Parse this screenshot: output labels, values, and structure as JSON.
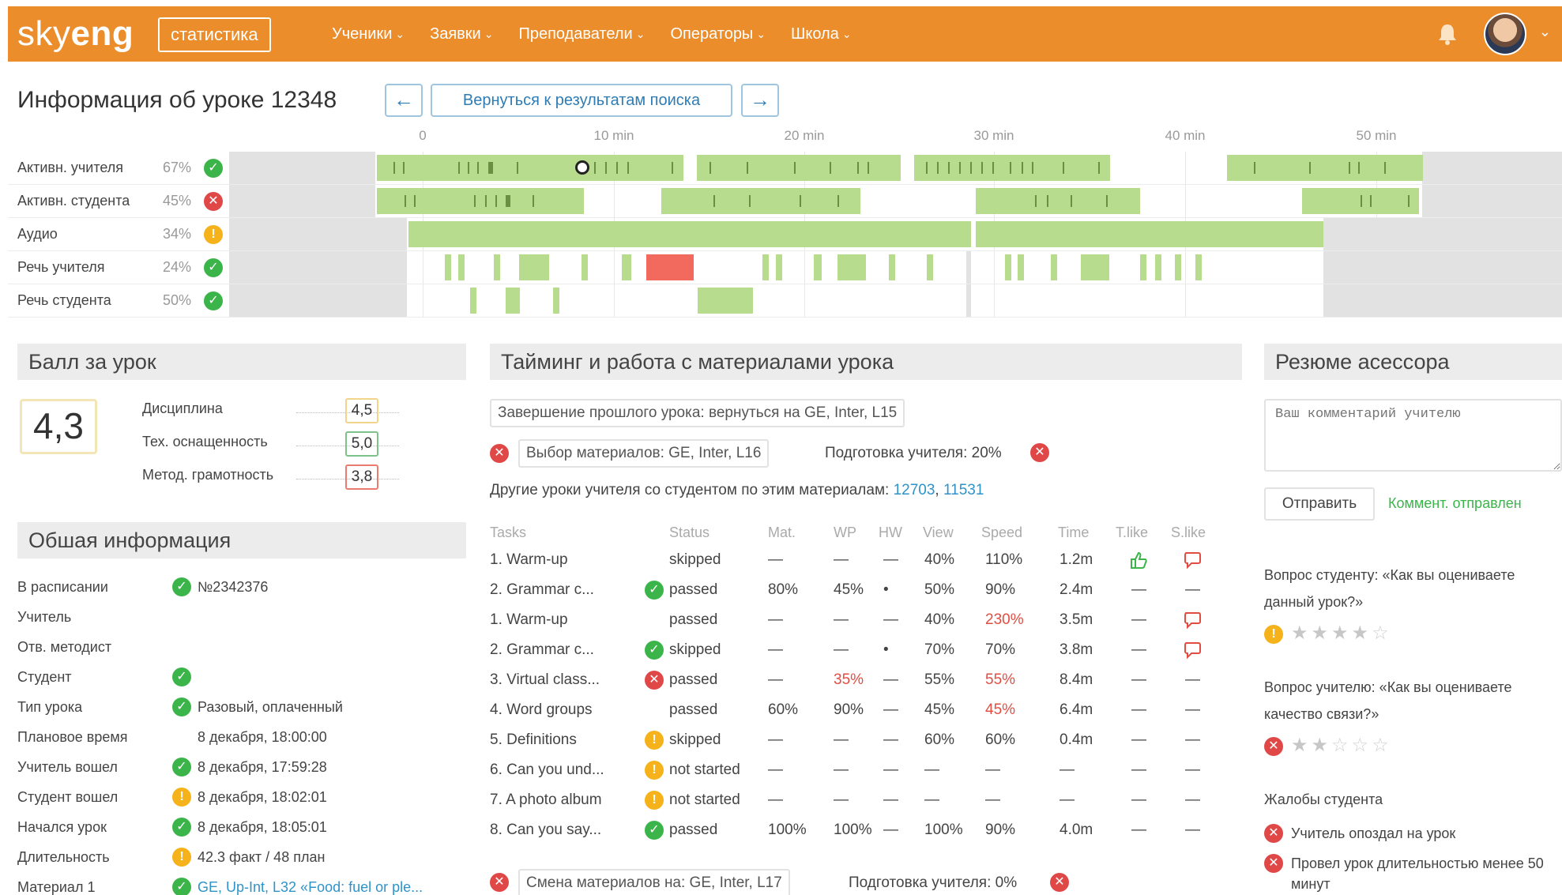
{
  "topbar": {
    "logo_light": "sky",
    "logo_bold": "eng",
    "stat_button": "статистика",
    "nav": [
      {
        "label": "Ученики"
      },
      {
        "label": "Заявки"
      },
      {
        "label": "Преподаватели"
      },
      {
        "label": "Операторы"
      },
      {
        "label": "Школа"
      }
    ],
    "accent_color": "#ec8d2c"
  },
  "lesson": {
    "title": "Информация об уроке 12348",
    "back_label": "Вернуться к результатам поиска",
    "prev_arrow": "←",
    "next_arrow": "→"
  },
  "timeline": {
    "ticks": [
      "0",
      "10 min",
      "20 min",
      "30 min",
      "40 min",
      "50 min"
    ],
    "rows": [
      {
        "label": "Активн. учителя",
        "pct": "67%",
        "status": "ok"
      },
      {
        "label": "Активн. студента",
        "pct": "45%",
        "status": "err"
      },
      {
        "label": "Аудио",
        "pct": "34%",
        "status": "warn"
      },
      {
        "label": "Речь учителя",
        "pct": "24%",
        "status": "ok"
      },
      {
        "label": "Речь студента",
        "pct": "50%",
        "status": "ok"
      }
    ]
  },
  "score": {
    "heading": "Балл за урок",
    "total": "4,3",
    "items": [
      {
        "label": "Дисциплина",
        "value": "4,5",
        "color": "#f2d48a"
      },
      {
        "label": "Тех. оснащенность",
        "value": "5,0",
        "color": "#7cc28a"
      },
      {
        "label": "Метод. грамотность",
        "value": "3,8",
        "color": "#ea7b6e"
      }
    ]
  },
  "info": {
    "heading": "Обшая информация",
    "rows": [
      {
        "label": "В расписании",
        "status": "ok",
        "value": "№2342376"
      },
      {
        "label": "Учитель",
        "status": "",
        "value": ""
      },
      {
        "label": "Отв. методист",
        "status": "",
        "value": ""
      },
      {
        "label": "Студент",
        "status": "ok",
        "value": ""
      },
      {
        "label": "Тип урока",
        "status": "ok",
        "value": "Разовый, оплаченный"
      },
      {
        "label": "Плановое время",
        "status": "",
        "value": "8 декабря, 18:00:00"
      },
      {
        "label": "Учитель вошел",
        "status": "ok",
        "value": "8 декабря, 17:59:28"
      },
      {
        "label": "Студент вошел",
        "status": "warn",
        "value": "8 декабря, 18:02:01"
      },
      {
        "label": "Начался урок",
        "status": "ok",
        "value": "8 декабря, 18:05:01"
      },
      {
        "label": "Длительность",
        "status": "warn",
        "value": "42.3 факт / 48 план"
      },
      {
        "label": "Материал 1",
        "status": "ok",
        "value": "GE, Up-Int, L32 «Food: fuel or ple..."
      }
    ]
  },
  "timing": {
    "heading": "Тайминг и работа с материалами урока",
    "prev_lesson": "Завершение прошлого урока: вернуться на GE, Inter, L15",
    "material_choice": "Выбор материалов: GE, Inter, L16",
    "teacher_prep": "Подготовка учителя: 20%",
    "other_lessons_label": "Другие уроки учителя со студентом по этим материалам:",
    "other_lessons": [
      "12703",
      "11531"
    ],
    "material_change": "Смена материалов на: GE, Inter, L17",
    "teacher_prep_2": "Подготовка учителя: 0%",
    "columns": [
      "Tasks",
      "Status",
      "Mat.",
      "WP",
      "HW",
      "View",
      "Speed",
      "Time",
      "T.like",
      "S.like"
    ],
    "rows": [
      {
        "task": "1. Warm-up",
        "dot": "",
        "status": "skipped",
        "mat": "—",
        "wp": "—",
        "hw": "—",
        "view": "40%",
        "speed": "110%",
        "time": "1.2m",
        "tlike": "thumb",
        "slike": "dislike",
        "wp_red": false,
        "speed_red": false
      },
      {
        "task": "2. Grammar c...",
        "dot": "ok",
        "status": "passed",
        "mat": "80%",
        "wp": "45%",
        "hw": "•",
        "view": "50%",
        "speed": "90%",
        "time": "2.4m",
        "tlike": "—",
        "slike": "—",
        "wp_red": false,
        "speed_red": false
      },
      {
        "task": "1. Warm-up",
        "dot": "",
        "status": "passed",
        "mat": "—",
        "wp": "—",
        "hw": "—",
        "view": "40%",
        "speed": "230%",
        "time": "3.5m",
        "tlike": "—",
        "slike": "dislike",
        "wp_red": false,
        "speed_red": true
      },
      {
        "task": "2. Grammar c...",
        "dot": "ok",
        "status": "skipped",
        "mat": "—",
        "wp": "—",
        "hw": "•",
        "view": "70%",
        "speed": "70%",
        "time": "3.8m",
        "tlike": "—",
        "slike": "dislike",
        "wp_red": false,
        "speed_red": false
      },
      {
        "task": "3. Virtual class...",
        "dot": "err",
        "status": "passed",
        "mat": "—",
        "wp": "35%",
        "hw": "—",
        "view": "55%",
        "speed": "55%",
        "time": "8.4m",
        "tlike": "—",
        "slike": "—",
        "wp_red": true,
        "speed_red": true
      },
      {
        "task": "4. Word groups",
        "dot": "",
        "status": "passed",
        "mat": "60%",
        "wp": "90%",
        "hw": "—",
        "view": "45%",
        "speed": "45%",
        "time": "6.4m",
        "tlike": "—",
        "slike": "—",
        "wp_red": false,
        "speed_red": true
      },
      {
        "task": "5. Definitions",
        "dot": "warn",
        "status": "skipped",
        "mat": "—",
        "wp": "—",
        "hw": "—",
        "view": "60%",
        "speed": "60%",
        "time": "0.4m",
        "tlike": "—",
        "slike": "—",
        "wp_red": false,
        "speed_red": false
      },
      {
        "task": "6. Can you und...",
        "dot": "warn",
        "status": "not started",
        "mat": "—",
        "wp": "—",
        "hw": "—",
        "view": "—",
        "speed": "—",
        "time": "—",
        "tlike": "—",
        "slike": "—",
        "wp_red": false,
        "speed_red": false
      },
      {
        "task": "7. A photo album",
        "dot": "warn",
        "status": "not started",
        "mat": "—",
        "wp": "—",
        "hw": "—",
        "view": "—",
        "speed": "—",
        "time": "—",
        "tlike": "—",
        "slike": "—",
        "wp_red": false,
        "speed_red": false
      },
      {
        "task": "8. Can you say...",
        "dot": "ok",
        "status": "passed",
        "mat": "100%",
        "wp": "100%",
        "hw": "—",
        "view": "100%",
        "speed": "90%",
        "time": "4.0m",
        "tlike": "—",
        "slike": "—",
        "wp_red": false,
        "speed_red": false
      }
    ]
  },
  "resume": {
    "heading": "Резюме асессора",
    "comment_placeholder": "Ваш комментарий учителю",
    "send_label": "Отправить",
    "sent_text": "Коммент. отправлен",
    "q_student": "Вопрос студенту: «Как вы оцениваете данный урок?»",
    "q_student_status": "warn",
    "q_student_rating": 4,
    "q_teacher": "Вопрос учителю: «Как вы оцениваете качество связи?»",
    "q_teacher_status": "err",
    "q_teacher_rating": 2,
    "complaints_label": "Жалобы студента",
    "complaints": [
      "Учитель опоздал на урок",
      "Провел урок длительностью менее 50 минут"
    ]
  }
}
